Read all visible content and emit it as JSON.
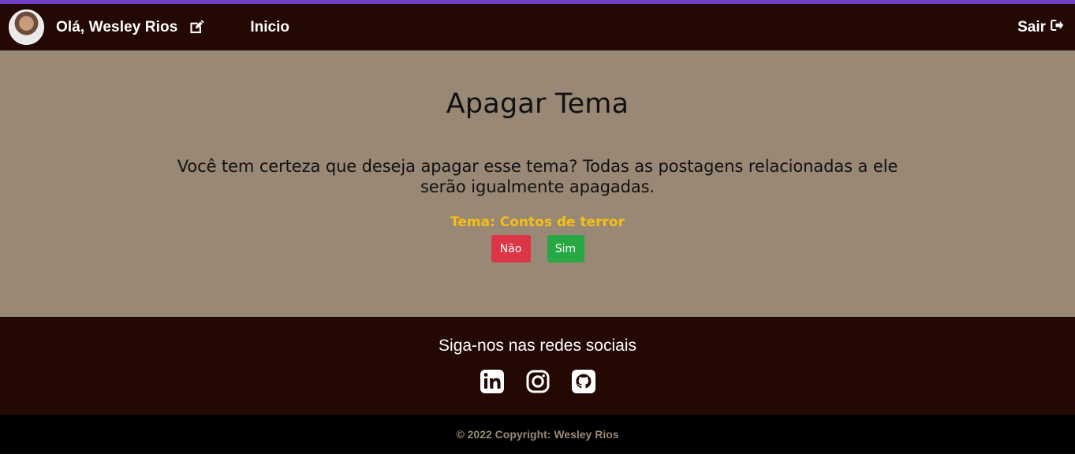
{
  "colors": {
    "accent_top": "#6f42c1",
    "nav_bg": "#230804",
    "main_bg": "#998875",
    "topic": "#f5bf16",
    "danger": "#dc3545",
    "success": "#28a745",
    "copyright_bg": "#000000",
    "copyright_text": "#998875"
  },
  "navbar": {
    "avatar_alt": "Wesley Rios avatar",
    "greeting": "Olá, Wesley Rios",
    "edit_icon": "edit-icon",
    "home_link": "Inicio",
    "logout_label": "Sair",
    "logout_icon": "sign-out-icon"
  },
  "main": {
    "title": "Apagar Tema",
    "message": "Você tem certeza que deseja apagar esse tema? Todas as postagens relacionadas a ele serão igualmente apagadas.",
    "topic": "Tema: Contos de terror",
    "buttons": {
      "no": "Não",
      "yes": "Sim"
    }
  },
  "footer": {
    "follow_title": "Siga-nos nas redes sociais",
    "social_icons": [
      "linkedin-icon",
      "instagram-icon",
      "github-icon"
    ],
    "copyright": "© 2022 Copyright: Wesley Rios"
  }
}
